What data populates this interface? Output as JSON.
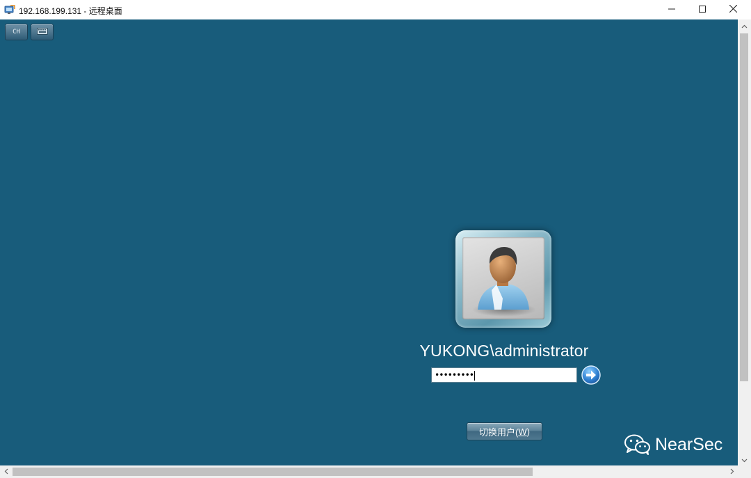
{
  "window": {
    "title": "192.168.199.131 - 远程桌面",
    "icons": {
      "app": "remote-desktop-icon",
      "minimize": "minimize-icon",
      "maximize": "maximize-icon",
      "close": "close-icon"
    }
  },
  "toolbar": {
    "language_label": "CH",
    "keyboard_icon": "keyboard-icon"
  },
  "login": {
    "username": "YUKONG\\administrator",
    "password_mask": "•••••••••",
    "avatar_icon": "user-avatar-icon",
    "submit_icon": "arrow-right-icon",
    "switch_user_label": "切换用户(",
    "switch_user_accel": "W",
    "switch_user_suffix": ")"
  },
  "watermark": {
    "text": "NearSec",
    "icon": "wechat-icon"
  },
  "colors": {
    "desktop_background": "#185c7b",
    "titlebar": "#ffffff",
    "scrollbar_track": "#f0f0f0",
    "scrollbar_thumb": "#c1c1c1"
  }
}
